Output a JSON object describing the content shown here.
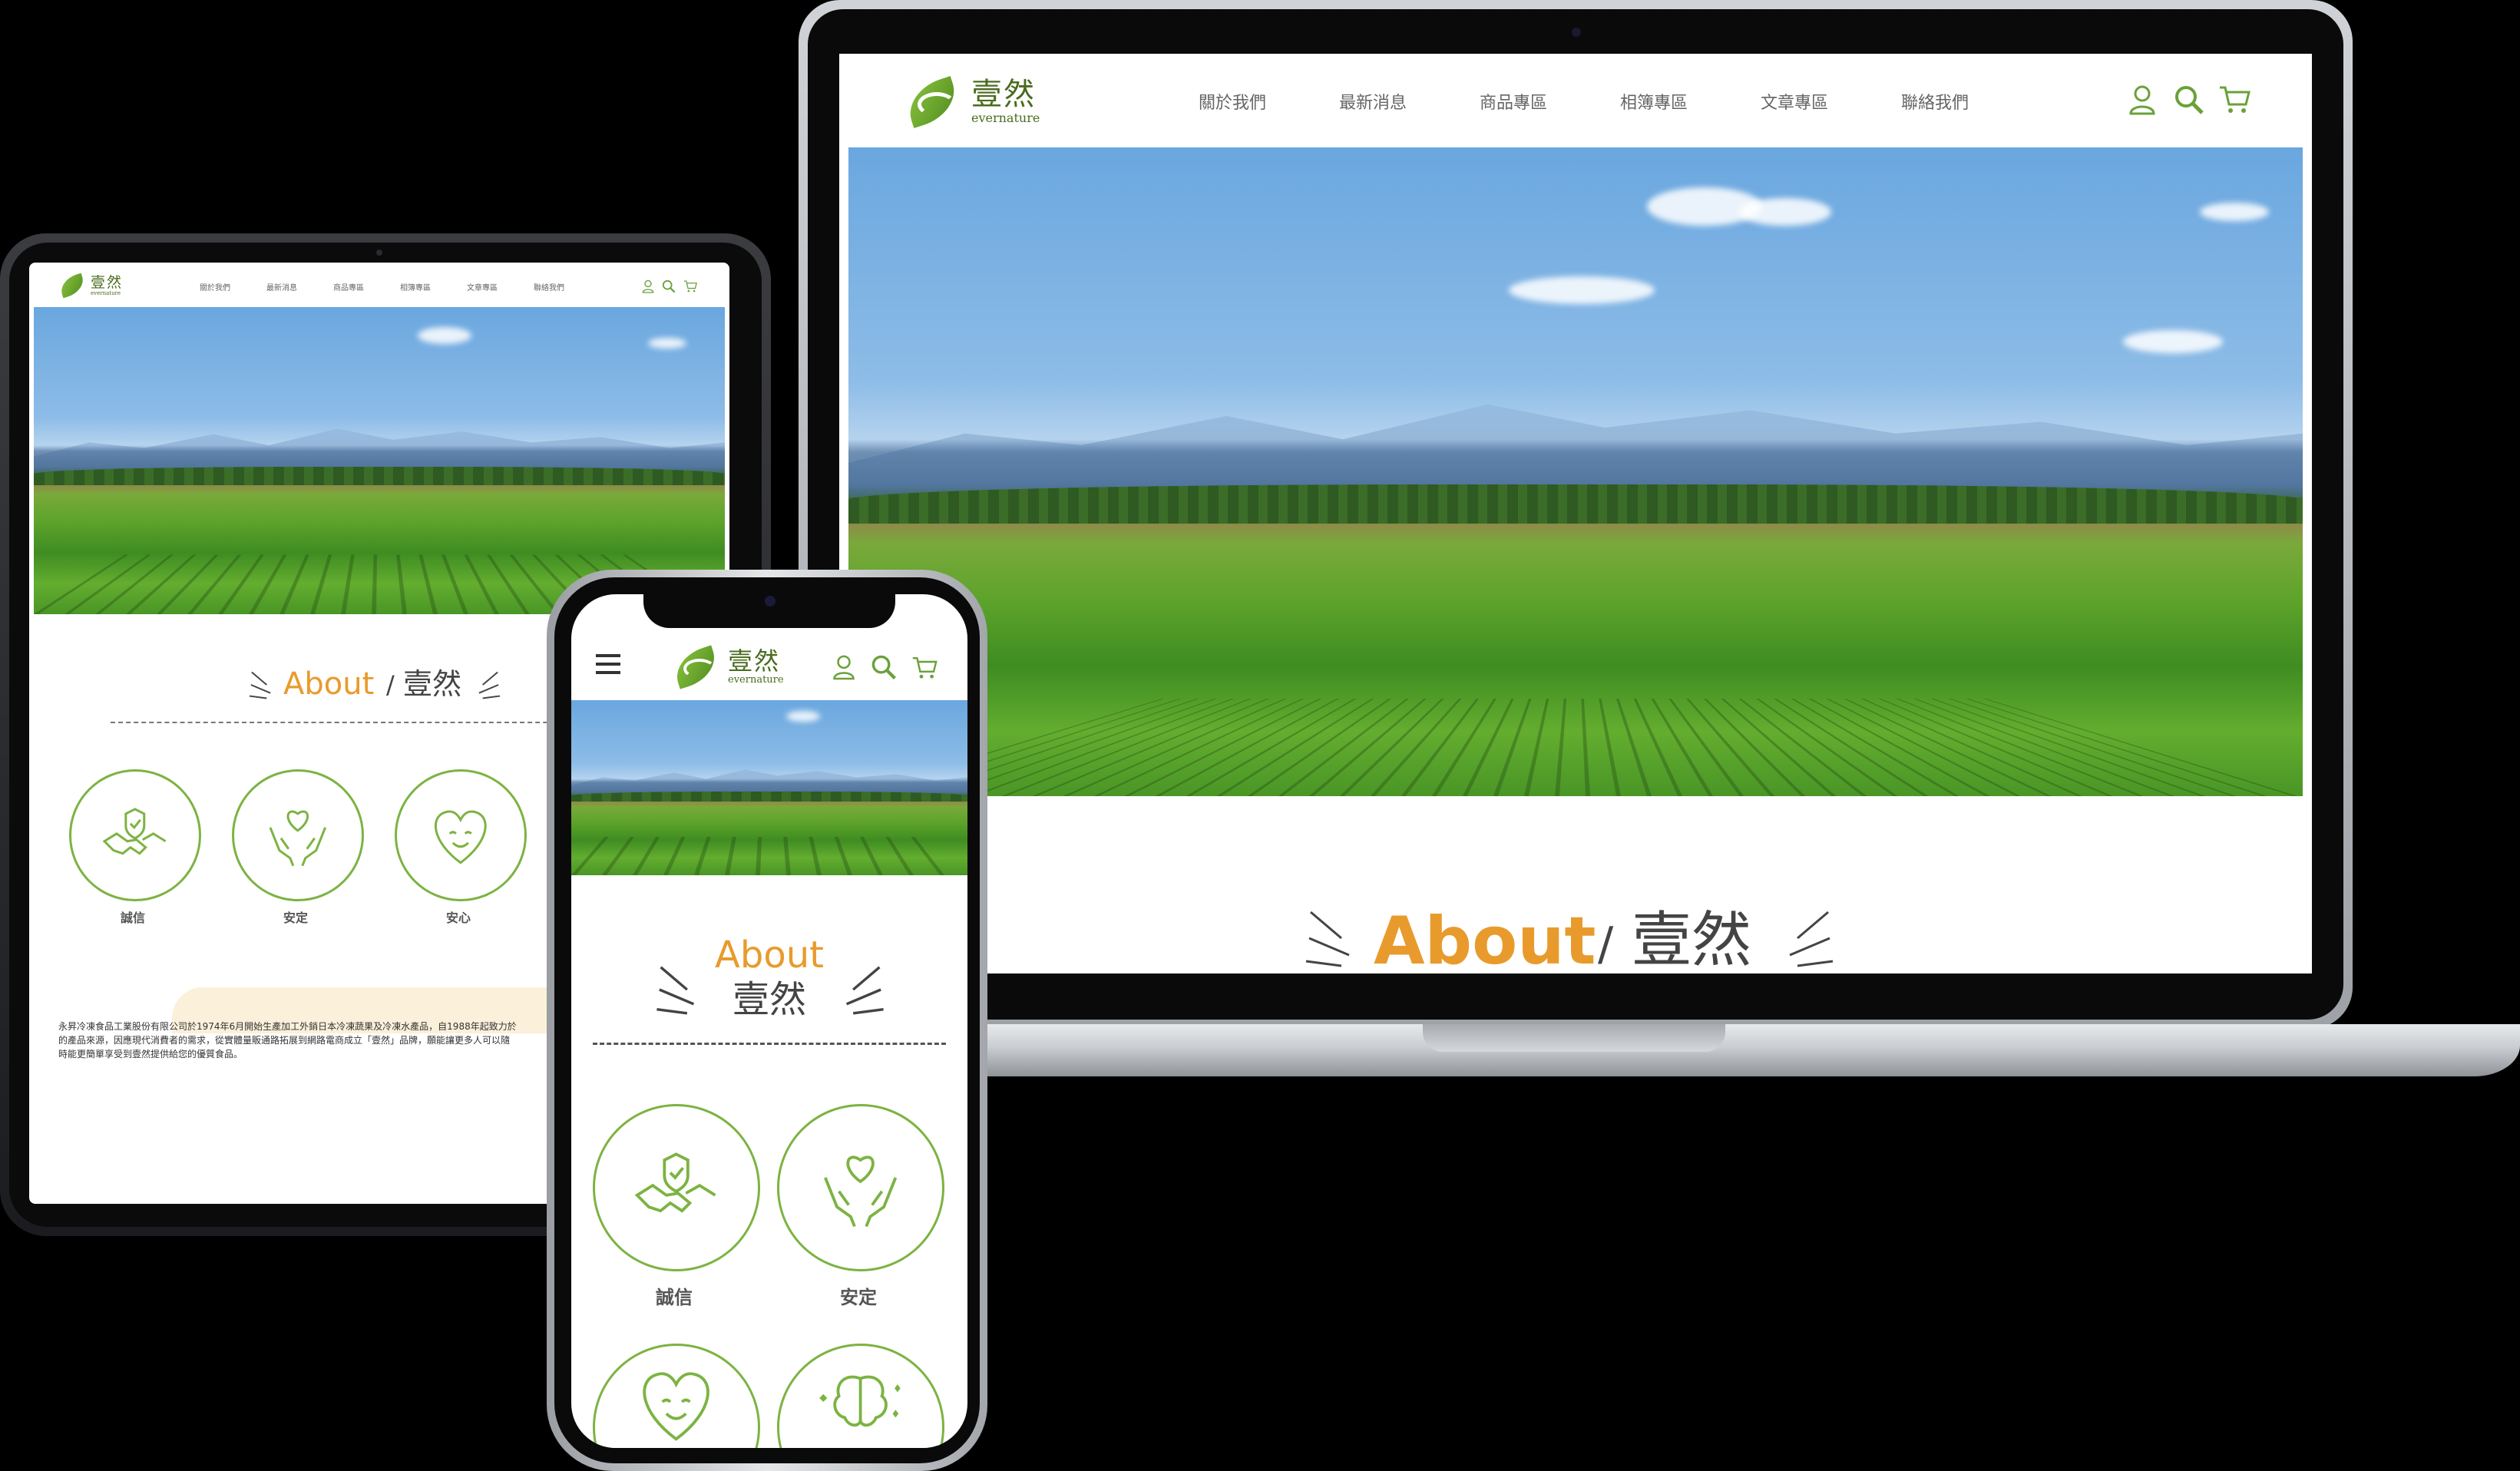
{
  "brand": {
    "name_cn": "壹然",
    "name_en": "evernature",
    "green": "#6aa13a",
    "orange": "#e89b2c"
  },
  "nav": {
    "items": [
      "關於我們",
      "最新消息",
      "商品專區",
      "相簿專區",
      "文章專區",
      "聯絡我們"
    ]
  },
  "icons": {
    "user": "user-icon",
    "search": "search-icon",
    "cart": "cart-icon",
    "menu": "hamburger-menu-icon"
  },
  "about": {
    "title_en": "About",
    "separator": "/",
    "title_cn": "壹然"
  },
  "values": [
    {
      "label": "誠信",
      "icon": "handshake-shield-icon"
    },
    {
      "label": "安定",
      "icon": "hands-heart-icon"
    },
    {
      "label": "安心",
      "icon": "smiling-heart-icon"
    },
    {
      "label": "",
      "icon": "brain-sparkle-icon"
    }
  ],
  "intro": {
    "line1": "永昇冷凍食品工業股份有限公司於1974年6月開始生產加工外銷日本冷凍蔬果及冷凍水產品，自1988年起致力於",
    "line2": "的產品來源，因應現代消費者的需求，從實體量販通路拓展到網路電商成立「壹然」品牌，願能讓更多人可以隨",
    "line3": "時能更簡單享受到壹然提供給您的優質食品。"
  }
}
